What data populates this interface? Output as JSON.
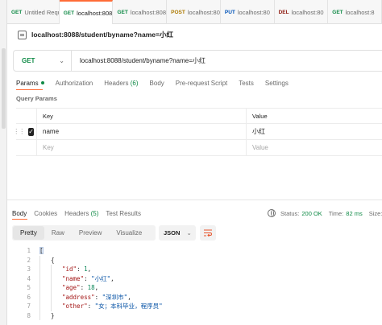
{
  "tabs": [
    {
      "method": "GET",
      "label": "Untitled Requ",
      "active": false,
      "cls": "m-get"
    },
    {
      "method": "GET",
      "label": "localhost:808",
      "active": true,
      "cls": "m-get"
    },
    {
      "method": "GET",
      "label": "localhost:808",
      "active": false,
      "cls": "m-get"
    },
    {
      "method": "POST",
      "label": "localhost:80",
      "active": false,
      "cls": "m-post"
    },
    {
      "method": "PUT",
      "label": "localhost:80",
      "active": false,
      "cls": "m-put"
    },
    {
      "method": "DEL",
      "label": "localhost:80",
      "active": false,
      "cls": "m-del"
    },
    {
      "method": "GET",
      "label": "localhost:8",
      "active": false,
      "cls": "m-get"
    }
  ],
  "request": {
    "title": "localhost:8088/student/byname?name=小红",
    "method": "GET",
    "url": "localhost:8088/student/byname?name=小红"
  },
  "request_tabs": {
    "params": "Params",
    "authorization": "Authorization",
    "headers": "Headers",
    "headers_count": "(6)",
    "body": "Body",
    "prerequest": "Pre-request Script",
    "tests": "Tests",
    "settings": "Settings"
  },
  "query_params": {
    "title": "Query Params",
    "key_header": "Key",
    "value_header": "Value",
    "row_key": "name",
    "row_value": "小红",
    "key_placeholder": "Key",
    "value_placeholder": "Value"
  },
  "response_tabs": {
    "body": "Body",
    "cookies": "Cookies",
    "headers": "Headers",
    "headers_count": "(5)",
    "test_results": "Test Results"
  },
  "status": {
    "status_label": "Status:",
    "status_value": "200 OK",
    "time_label": "Time:",
    "time_value": "82 ms",
    "size_label": "Size:"
  },
  "view": {
    "pretty": "Pretty",
    "raw": "Raw",
    "preview": "Preview",
    "visualize": "Visualize",
    "format": "JSON"
  },
  "response_body": {
    "line_numbers": [
      "1",
      "2",
      "3",
      "4",
      "5",
      "6",
      "7",
      "8"
    ],
    "open_bracket": "[",
    "open_brace": "{",
    "close_brace": "}",
    "k_id": "\"id\"",
    "v_id": "1",
    "k_name": "\"name\"",
    "v_name": "\"小红\"",
    "k_age": "\"age\"",
    "v_age": "18",
    "k_address": "\"address\"",
    "v_address": "\"深圳市\"",
    "k_other": "\"other\"",
    "v_other": "\"女；本科毕业，程序员\""
  },
  "colors": {
    "accent": "#ff6c37",
    "get": "#0f8a46",
    "post": "#ad7a03",
    "put": "#0053b8",
    "delete": "#8e1a10"
  }
}
